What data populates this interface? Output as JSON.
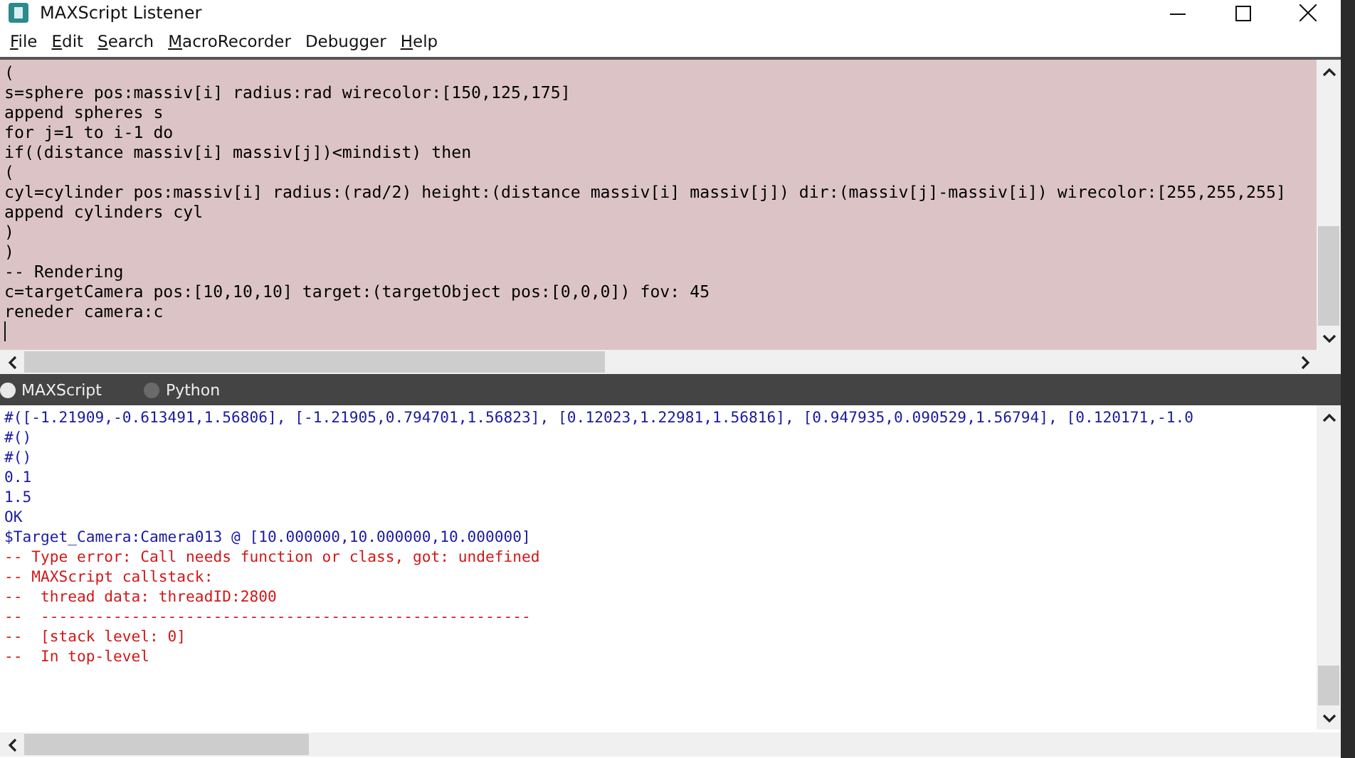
{
  "window": {
    "title": "MAXScript Listener"
  },
  "menu": [
    {
      "label": "File",
      "underlined": true
    },
    {
      "label": "Edit",
      "underlined": true
    },
    {
      "label": "Search",
      "underlined": true
    },
    {
      "label": "MacroRecorder",
      "underlined": true
    },
    {
      "label": "Debugger",
      "underlined": false
    },
    {
      "label": "Help",
      "underlined": true
    }
  ],
  "editor": {
    "lines": [
      "(",
      "s=sphere pos:massiv[i] radius:rad wirecolor:[150,125,175]",
      "append spheres s",
      "for j=1 to i-1 do",
      "if((distance massiv[i] massiv[j])<mindist) then",
      "(",
      "cyl=cylinder pos:massiv[i] radius:(rad/2) height:(distance massiv[i] massiv[j]) dir:(massiv[j]-massiv[i]) wirecolor:[255,255,255]",
      "append cylinders cyl",
      ")",
      ")",
      "-- Rendering",
      "c=targetCamera pos:[10,10,10] target:(targetObject pos:[0,0,0]) fov: 45",
      "reneder camera:c"
    ]
  },
  "language_options": [
    {
      "label": "MAXScript",
      "selected": true
    },
    {
      "label": "Python",
      "selected": false
    }
  ],
  "output": {
    "lines": [
      {
        "text": "#([-1.21909,-0.613491,1.56806], [-1.21905,0.794701,1.56823], [0.12023,1.22981,1.56816], [0.947935,0.090529,1.56794], [0.120171,-1.0",
        "kind": "result"
      },
      {
        "text": "#()",
        "kind": "result"
      },
      {
        "text": "#()",
        "kind": "result"
      },
      {
        "text": "0.1",
        "kind": "result"
      },
      {
        "text": "1.5",
        "kind": "result"
      },
      {
        "text": "OK",
        "kind": "result"
      },
      {
        "text": "$Target_Camera:Camera013 @ [10.000000,10.000000,10.000000]",
        "kind": "result"
      },
      {
        "text": "-- Type error: Call needs function or class, got: undefined",
        "kind": "error"
      },
      {
        "text": "-- MAXScript callstack:",
        "kind": "error"
      },
      {
        "text": "--  thread data: threadID:2800",
        "kind": "error"
      },
      {
        "text": "--  ------------------------------------------------------",
        "kind": "error"
      },
      {
        "text": "--  [stack level: 0]",
        "kind": "error"
      },
      {
        "text": "--  In top-level",
        "kind": "error"
      }
    ]
  }
}
